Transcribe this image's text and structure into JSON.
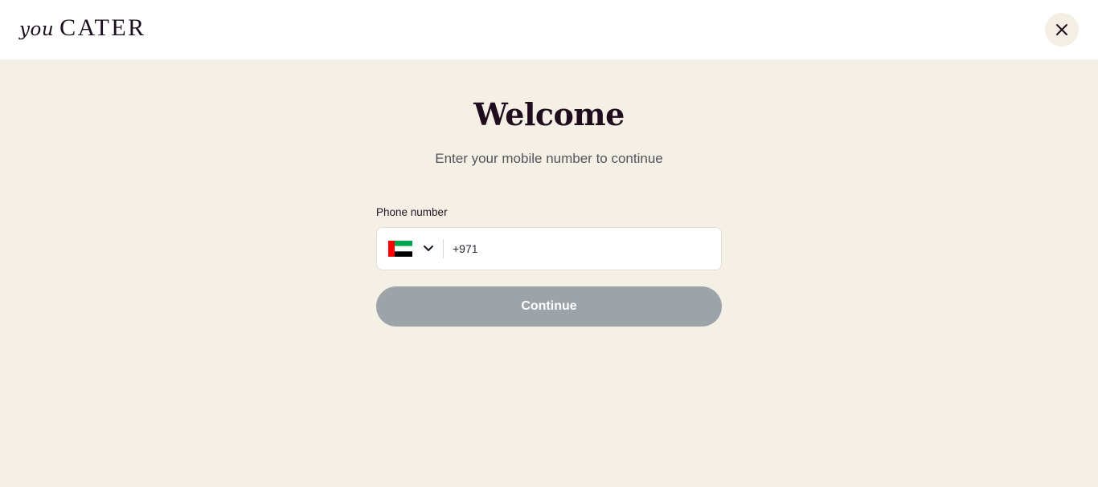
{
  "header": {
    "logo_prefix": "you",
    "logo_name": "CATER",
    "close_icon": "close-icon"
  },
  "main": {
    "title": "Welcome",
    "subtitle": "Enter your mobile number to continue",
    "phone_label": "Phone number",
    "country": {
      "flag_icon": "uae-flag-icon",
      "dropdown_icon": "chevron-down-icon",
      "flag_colors": {
        "red": "#ff0000",
        "green": "#00a651",
        "white": "#ffffff",
        "black": "#000000"
      }
    },
    "phone_value": "+971",
    "continue_label": "Continue"
  },
  "colors": {
    "page_background": "#f5f0e6",
    "header_background": "#ffffff",
    "heading_text": "#1f0d1e",
    "button_disabled": "#9ca3a9",
    "close_button_bg": "#f4eee4"
  }
}
